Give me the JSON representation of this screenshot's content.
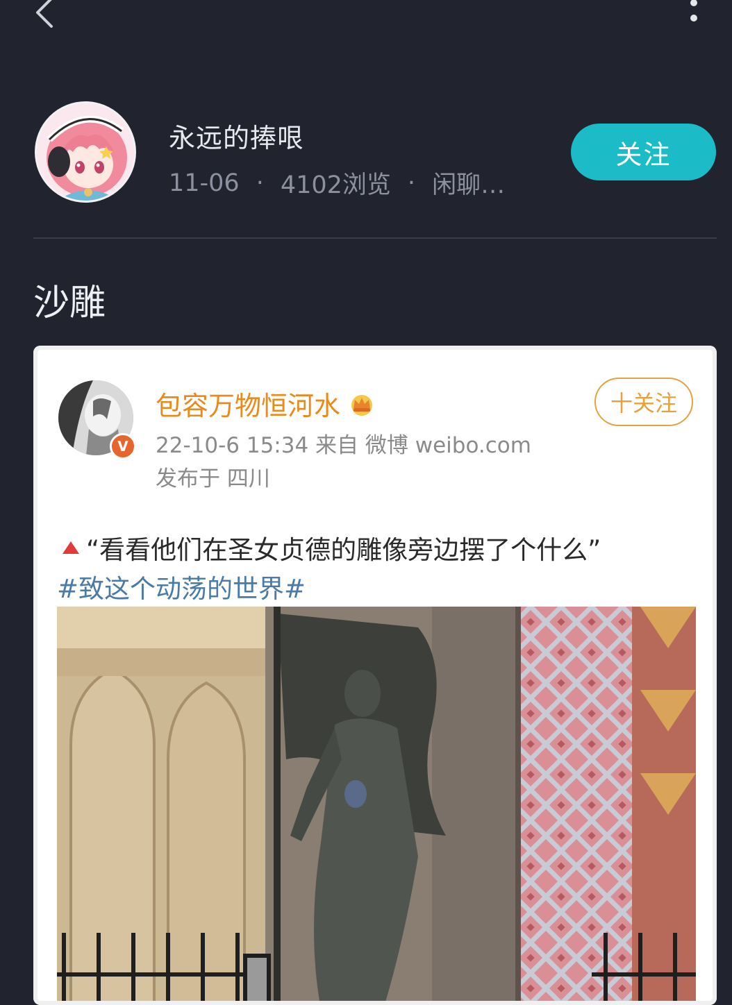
{
  "topbar": {
    "back_icon": "chevron-left-icon",
    "more_icon": "vertical-ellipsis-icon"
  },
  "author": {
    "name": "永远的捧哏",
    "date": "11-06",
    "views": "4102浏览",
    "category": "闲聊…",
    "separator": "·",
    "follow_label": "关注"
  },
  "post": {
    "title": "沙雕"
  },
  "embedded_weibo": {
    "user_name": "包容万物恒河水",
    "verified_badge": "V",
    "follow_label": "十关注",
    "meta": "22-10-6 15:34  来自 微博 weibo.com",
    "location": "发布于 四川",
    "text": "“看看他们在圣女贞德的雕像旁边摆了个什么”",
    "hashtag": "#致这个动荡的世界#"
  },
  "colors": {
    "background": "#21232f",
    "accent": "#1bbcc7",
    "weibo_name": "#e98a1a",
    "hashtag": "#4a7ba6"
  }
}
